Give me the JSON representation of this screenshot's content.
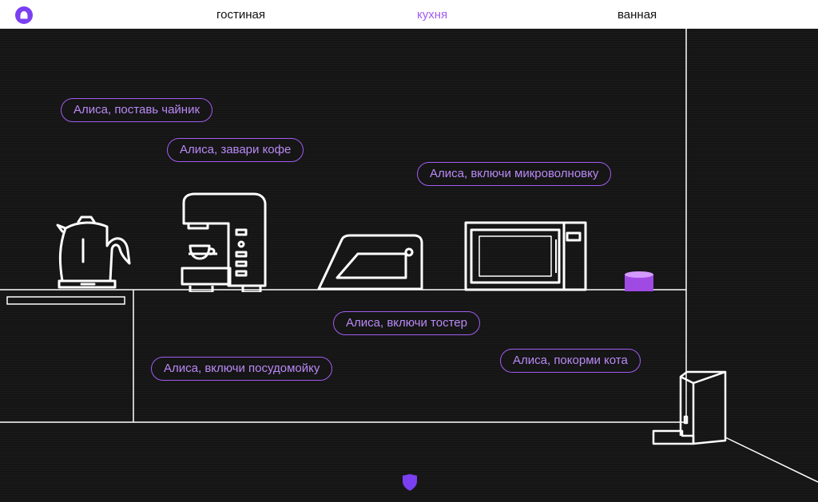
{
  "nav": {
    "tabs": [
      {
        "label": "гостиная",
        "active": false
      },
      {
        "label": "кухня",
        "active": true
      },
      {
        "label": "ванная",
        "active": false
      }
    ]
  },
  "commands": {
    "kettle": "Алиса, поставь чайник",
    "coffee": "Алиса, завари кофе",
    "microwave": "Алиса, включи микроволновку",
    "toaster": "Алиса, включи тостер",
    "dishwasher": "Алиса, включи посудомойку",
    "cat_feeder": "Алиса, покорми кота"
  },
  "colors": {
    "accent": "#a25cf0",
    "brand": "#7b3ff2",
    "background": "#151515",
    "line": "#ffffff"
  },
  "icons": {
    "logo": "alice-logo-icon",
    "bottom": "shield-icon"
  }
}
